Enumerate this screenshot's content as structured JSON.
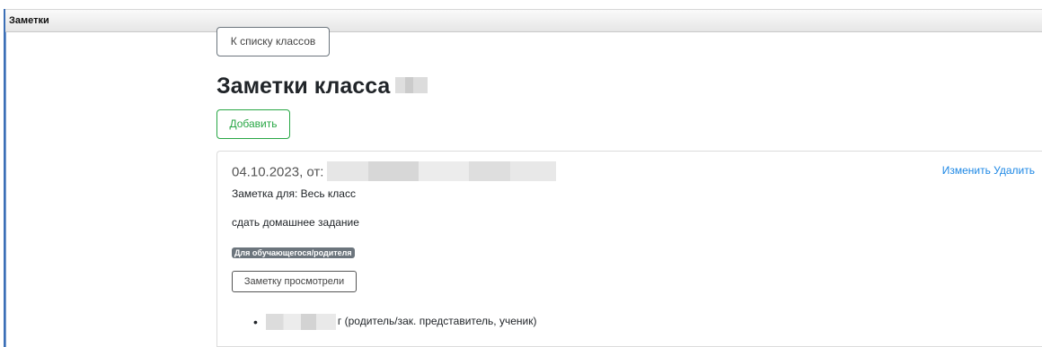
{
  "window": {
    "title": "Заметки"
  },
  "back_button": {
    "label": "К списку классов"
  },
  "page": {
    "title": "Заметки класса"
  },
  "add_button": {
    "label": "Добавить"
  },
  "note": {
    "header": "04.10.2023, от:",
    "edit_label": "Изменить",
    "delete_label": "Удалить",
    "for_text": "Заметка для: Весь класс",
    "body": "сдать домашнее задание",
    "badge": "Для обучающегося/родителя",
    "viewed_button": "Заметку просмотрели",
    "viewers": [
      {
        "suffix": "г (родитель/зак. представитель, ученик)"
      }
    ]
  },
  "colors": {
    "accent_link": "#1e88e5",
    "success": "#28a745",
    "badge_bg": "#6c757d",
    "window_border": "#3b6fb6"
  }
}
